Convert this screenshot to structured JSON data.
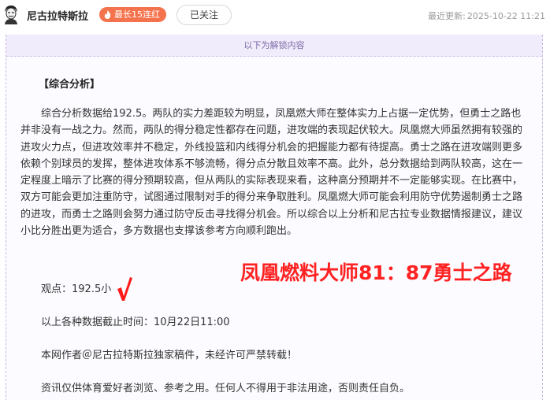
{
  "header": {
    "author_name": "尼古拉特斯拉",
    "streak_badge": "最长15连红",
    "follow_button": "已关注",
    "updated_label": "最近更新:",
    "updated_time": "2025-10-22 11:21"
  },
  "unlock_notice": "以下为解锁内容",
  "article": {
    "section_title": "【综合分析】",
    "analysis_text": "综合分析数据给192.5。两队的实力差距较为明显，凤凰燃大师在整体实力上占据一定优势，但勇士之路也并非没有一战之力。然而，两队的得分稳定性都存在问题，进攻端的表现起伏较大。凤凰燃大师虽然拥有较强的进攻火力点，但进攻效率并不稳定，外线投篮和内线得分机会的把握能力都有待提高。勇士之路在进攻端则更多依赖个别球员的发挥，整体进攻体系不够流畅，得分点分散且效率不高。此外，总分数据给到两队较高，这在一定程度上暗示了比赛的得分预期较高，但从两队的实际表现来看，这种高分预期并不一定能够实现。在比赛中，双方可能会更加注重防守，试图通过限制对手的得分来争取胜利。凤凰燃大师可能会利用防守优势遏制勇士之路的进攻，而勇士之路则会努力通过防守反击寻找得分机会。所以综合以上分析和尼古拉专业数据情报建议，建议小比分胜出更为适合，多方数据也支撑该参考方向顺利跑出。",
    "view_line": "观点：192.5小",
    "overlay_score": "凤凰燃料大师81：87勇士之路",
    "cutoff_line": "以上各种数据截止时间：10月22日11:00",
    "copyright_line": "本网作者＠尼古拉特斯拉独家稿件，未经许可严禁转载！",
    "disclaimer_line": "资讯仅供体育爱好者浏览、参考之用。任何人不得用于非法用途，否则责任自负。"
  },
  "icons": {
    "avatar": "portrait-avatar",
    "streak": "flame-icon",
    "check": "red-checkmark"
  },
  "colors": {
    "streak_badge": "#f4734d",
    "unlock_bar": "#f1ecfb",
    "overlay_text": "#ff2222",
    "checkmark": "#ff1a1a"
  }
}
